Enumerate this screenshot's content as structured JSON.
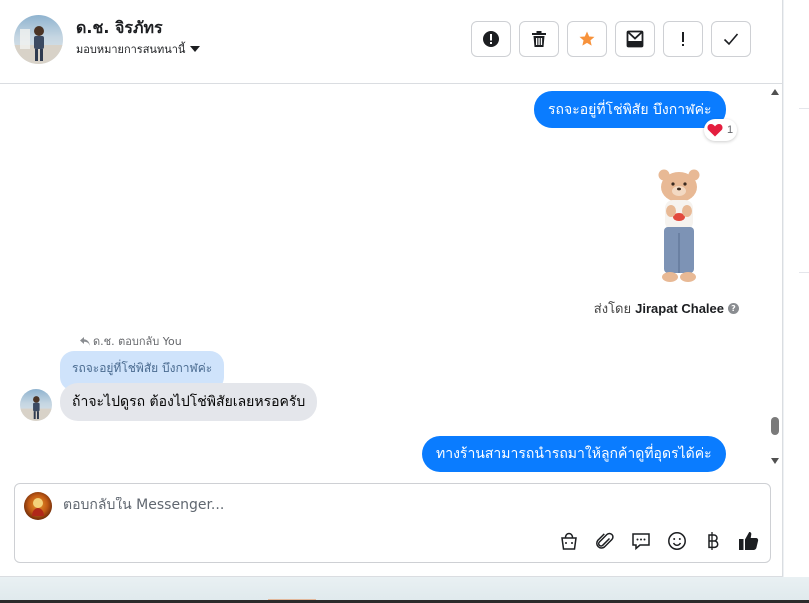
{
  "header": {
    "contact_name": "ด.ช. จิรภัทร",
    "assign_label": "มอบหมายการสนทนานี้"
  },
  "toolbar": {
    "icons": [
      "exclamation-circle-icon",
      "trash-icon",
      "star-icon",
      "envelope-icon",
      "exclamation-icon",
      "check-icon"
    ],
    "star_color": "#f7923b"
  },
  "messages": {
    "out_1": "รถจะอยู่ที่โช่พิสัย บึงกาฬค่ะ",
    "reaction_count": "1",
    "sent_by_prefix": "ส่งโดย",
    "sent_by_name": "Jirapat Chalee",
    "reply_meta": "ด.ช. ตอบกลับ You",
    "quoted_text": "รถจะอยู่ที่โช่พิสัย บึงกาฬค่ะ",
    "in_1": "ถ้าจะไปดูรถ ต้องไปโช่พิสัยเลยหรอครับ",
    "out_2": "ทางร้านสามารถนำรถมาให้ลูกค้าดูที่อุดรได้ค่ะ"
  },
  "composer": {
    "placeholder": "ตอบกลับใน Messenger..."
  },
  "colors": {
    "accent": "#0a7cff",
    "incoming_bubble": "#e4e6eb",
    "quote_bubble": "#cfe3fb"
  }
}
